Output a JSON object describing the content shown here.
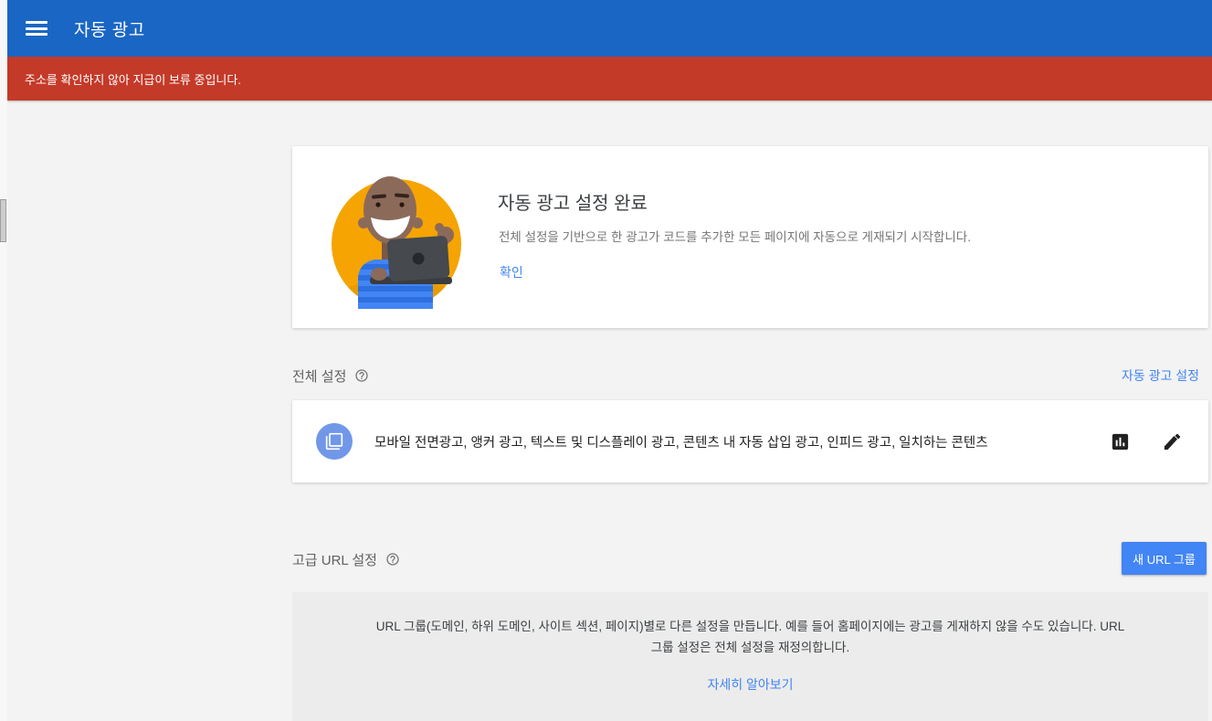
{
  "header": {
    "title": "자동 광고"
  },
  "alert": {
    "message": "주소를 확인하지 않아 지급이 보류 중입니다."
  },
  "completion_card": {
    "title": "자동 광고 설정 완료",
    "description": "전체 설정을 기반으로 한 광고가 코드를 추가한 모든 페이지에 자동으로 게재되기 시작합니다.",
    "confirm_label": "확인"
  },
  "global_settings": {
    "label": "전체 설정",
    "settings_link": "자동 광고 설정",
    "ad_formats": "모바일 전면광고, 앵커 광고, 텍스트 및 디스플레이 광고, 콘텐츠 내 자동 삽입 광고, 인피드 광고, 일치하는 콘텐츠"
  },
  "advanced_url": {
    "label": "고급 URL 설정",
    "new_group_button": "새 URL 그룹",
    "description": "URL 그룹(도메인, 하위 도메인, 사이트 섹션, 페이지)별로 다른 설정을 만듭니다. 예를 들어 홈페이지에는 광고를 게재하지 않을 수도 있습니다. URL 그룹 설정은 전체 설정을 재정의합니다.",
    "learn_more": "자세히 알아보기"
  },
  "icons": {
    "menu": "menu-icon",
    "help": "help-circle-icon",
    "ad_formats_badge": "layered-pages-icon",
    "reports": "bar-chart-icon",
    "edit": "pencil-icon",
    "illustration": "person-with-laptop-illustration"
  },
  "colors": {
    "header_blue": "#1a66c4",
    "alert_red": "#c43a29",
    "accent_blue": "#4285f4",
    "badge_circle_blue": "#7197e9",
    "illustration_amber": "#f5a402",
    "page_background": "#f3f3f3",
    "panel_gray": "#ececec"
  }
}
